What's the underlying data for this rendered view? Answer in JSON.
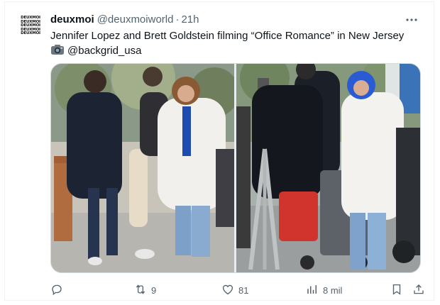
{
  "account": {
    "avatar_text": "DEUXMOI",
    "name": "deuxmoi",
    "handle": "@deuxmoiworld",
    "separator": "·",
    "time": "21h"
  },
  "tweet": {
    "text_line1": "Jennifer Lopez and Brett Goldstein filming “Office Romance” in New Jersey",
    "credit": "@backgrid_usa"
  },
  "media": {
    "left_photo_icon": "photo-image",
    "right_photo_icon": "photo-image"
  },
  "actions": {
    "reply_count": "",
    "retweet_count": "9",
    "like_count": "81",
    "views_count": "8 mil"
  },
  "icons": {
    "more": "more-icon",
    "reply": "reply-icon",
    "retweet": "retweet-icon",
    "like": "heart-icon",
    "views": "views-icon",
    "bookmark": "bookmark-icon",
    "share": "share-icon",
    "camera": "camera-icon"
  },
  "colors": {
    "text": "#0f1419",
    "secondary": "#536471",
    "border": "#cfd9de"
  }
}
